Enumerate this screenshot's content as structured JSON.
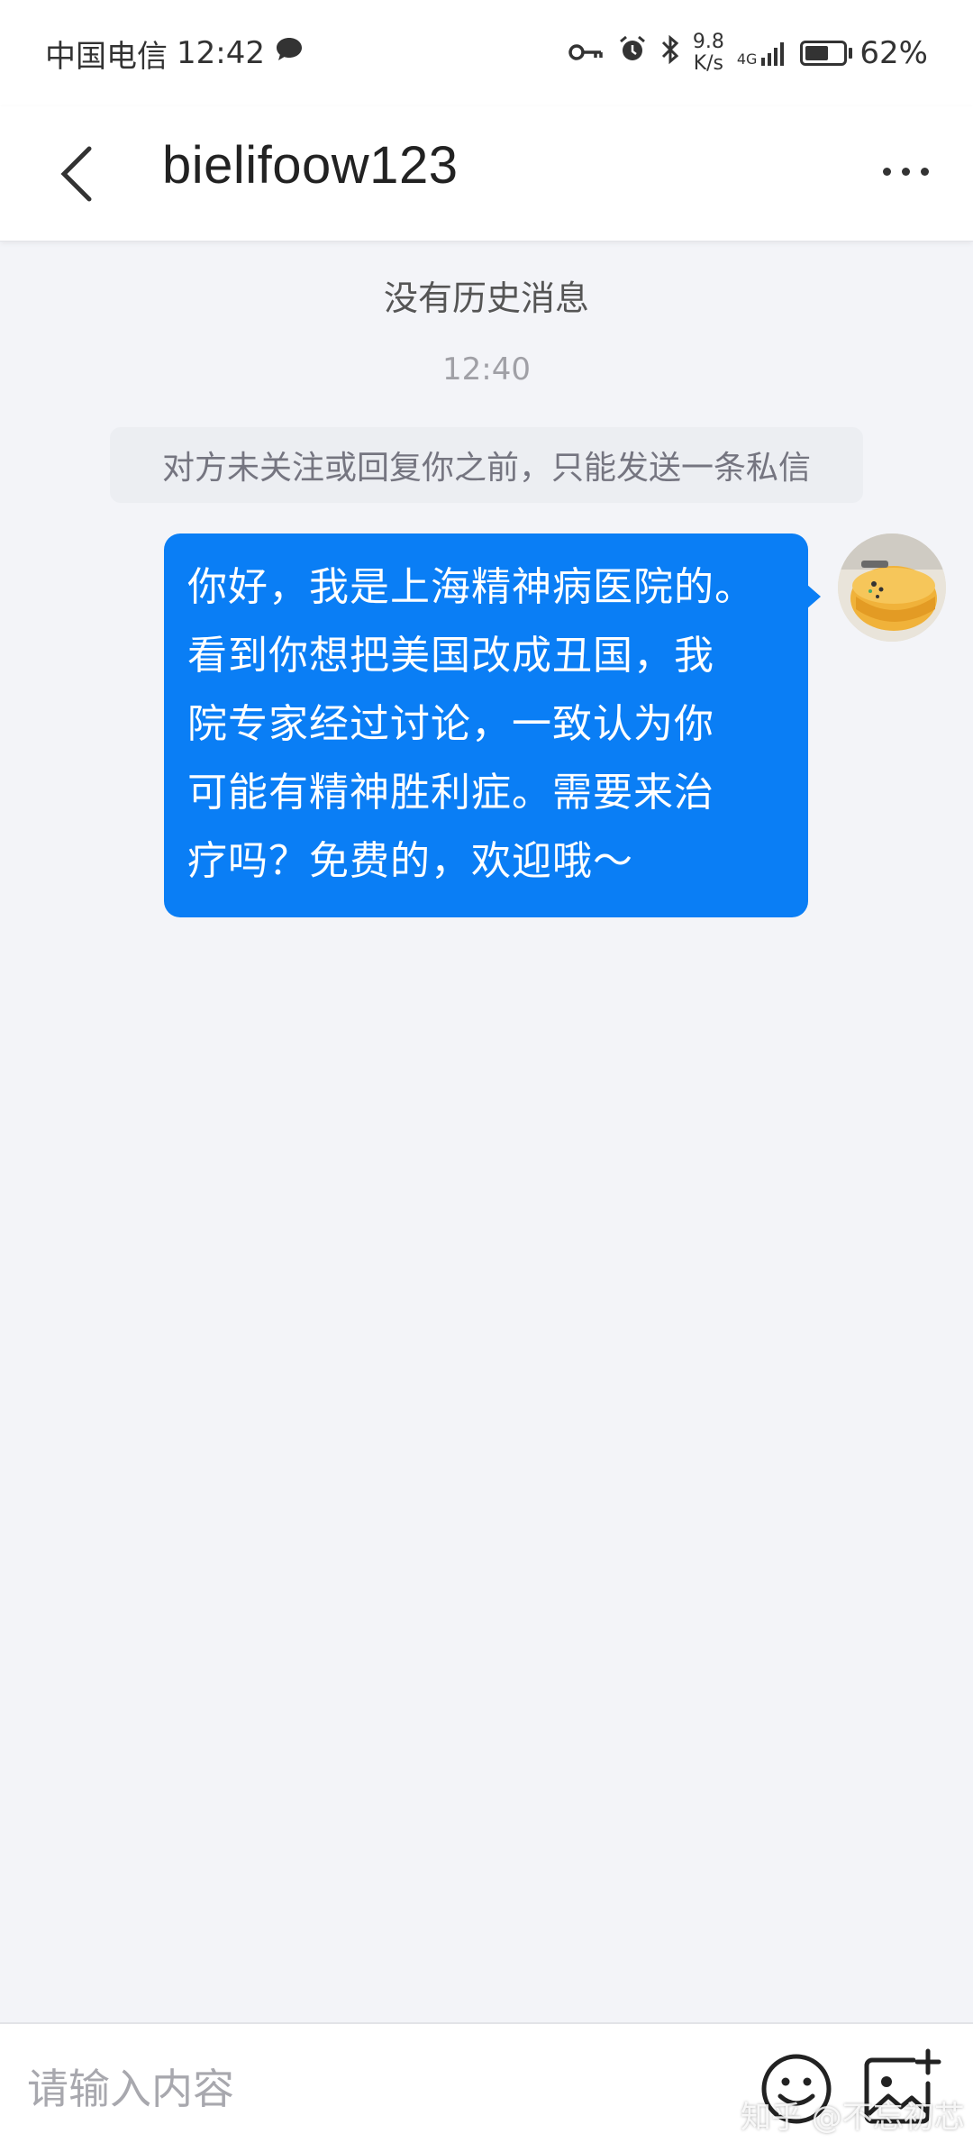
{
  "status_bar": {
    "carrier": "中国电信",
    "time": "12:42",
    "net_speed_value": "9.8",
    "net_speed_unit": "K/s",
    "network_type": "4G",
    "battery_percent": "62%",
    "battery_level": 0.62
  },
  "header": {
    "title": "bielifoow123"
  },
  "chat": {
    "no_history": "没有历史消息",
    "timestamp": "12:40",
    "notice": "对方未关注或回复你之前，只能发送一条私信",
    "messages": [
      {
        "lines": [
          "你好，我是上海精神病医院的。",
          "看到你想把美国改成丑国，我",
          "院专家经过讨论，一致认为你",
          "可能有精神胜利症。需要来治",
          "疗吗？免费的，欢迎哦～"
        ]
      }
    ]
  },
  "input_bar": {
    "placeholder": "请输入内容"
  },
  "watermark": "知乎 @不忘初芯",
  "colors": {
    "accent": "#0a7ef5",
    "background": "#f3f4f8"
  }
}
